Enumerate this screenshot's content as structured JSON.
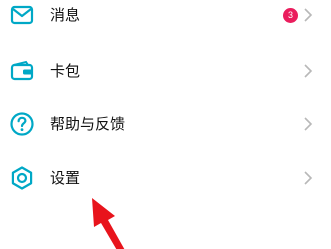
{
  "accent_color": "#00a8c6",
  "badge_color": "#ea1d5d",
  "arrow_color": "#e8141c",
  "menu": {
    "items": [
      {
        "label": "消息",
        "icon": "envelope-icon",
        "badge": "3"
      },
      {
        "label": "卡包",
        "icon": "wallet-icon"
      },
      {
        "label": "帮助与反馈",
        "icon": "help-icon"
      },
      {
        "label": "设置",
        "icon": "settings-icon"
      }
    ]
  }
}
